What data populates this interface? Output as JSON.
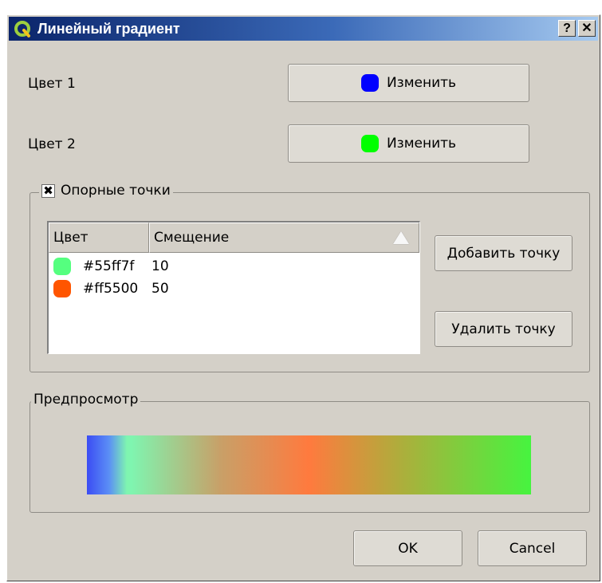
{
  "window": {
    "title": "Линейный градиент",
    "help_button": "?",
    "close_button": "✕"
  },
  "color1": {
    "label": "Цвет 1",
    "button": "Изменить",
    "color": "#0000ff"
  },
  "color2": {
    "label": "Цвет 2",
    "button": "Изменить",
    "color": "#00ff00"
  },
  "stops": {
    "title": "Опорные точки",
    "checked": true,
    "columns": [
      "Цвет",
      "Смещение"
    ],
    "rows": [
      {
        "color_text": "#55ff7f",
        "offset": "10",
        "color": "#55ff7f"
      },
      {
        "color_text": "#ff5500",
        "offset": "50",
        "color": "#ff5500"
      }
    ],
    "add_button": "Добавить точку",
    "remove_button": "Удалить точку"
  },
  "preview": {
    "title": "Предпросмотр"
  },
  "footer": {
    "ok": "OK",
    "cancel": "Cancel"
  }
}
